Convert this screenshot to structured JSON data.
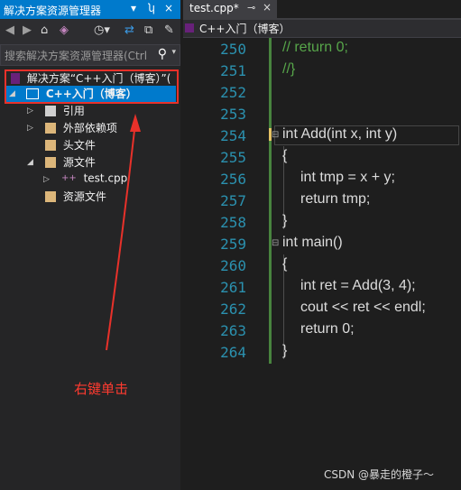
{
  "solution_explorer": {
    "title": "解决方案资源管理器",
    "title_controls": [
      "▾",
      "ʮ",
      "×"
    ],
    "toolbar_icons": [
      "back-icon",
      "forward-icon",
      "home-icon",
      "solution-icon",
      "history-icon",
      "sync-icon",
      "collapse-icon",
      "properties-icon"
    ],
    "search_placeholder": "搜索解决方案资源管理器(Ctrl",
    "tree": [
      {
        "label": "解决方案“C++入门（博客）”(",
        "icon": "solution-icon"
      },
      {
        "label": "C++入门（博客）",
        "icon": "project-icon",
        "selected": true
      },
      {
        "label": "引用",
        "icon": "references-icon"
      },
      {
        "label": "外部依赖项",
        "icon": "external-deps-icon"
      },
      {
        "label": "头文件",
        "icon": "folder-icon"
      },
      {
        "label": "源文件",
        "icon": "folder-icon"
      },
      {
        "label": "test.cpp",
        "icon": "cpp-file-icon"
      },
      {
        "label": "资源文件",
        "icon": "folder-icon"
      }
    ]
  },
  "annotation": {
    "text": "右键单击",
    "color": "#ff3b30"
  },
  "editor": {
    "tab": {
      "label": "test.cpp*",
      "pin": "⊸",
      "close": "×"
    },
    "nav_project": "C++入门（博客）",
    "lines": [
      {
        "num": "250",
        "code": "// return 0;"
      },
      {
        "num": "251",
        "code": "//}"
      },
      {
        "num": "252",
        "code": ""
      },
      {
        "num": "253",
        "code": ""
      },
      {
        "num": "254",
        "code": "int Add(int x, int y)"
      },
      {
        "num": "255",
        "code": "{"
      },
      {
        "num": "256",
        "code": "int tmp = x + y;"
      },
      {
        "num": "257",
        "code": "return tmp;"
      },
      {
        "num": "258",
        "code": "}"
      },
      {
        "num": "259",
        "code": "int main()"
      },
      {
        "num": "260",
        "code": "{"
      },
      {
        "num": "261",
        "code": "int ret = Add(3, 4);"
      },
      {
        "num": "262",
        "code": "cout << ret << endl;"
      },
      {
        "num": "263",
        "code": "return 0;"
      },
      {
        "num": "264",
        "code": "}"
      }
    ]
  },
  "watermark": "CSDN @暴走的橙子～",
  "colors": {
    "accent": "#007acc",
    "linenum": "#2b91af",
    "keyword": "#569cd6",
    "comment": "#57a64a"
  }
}
